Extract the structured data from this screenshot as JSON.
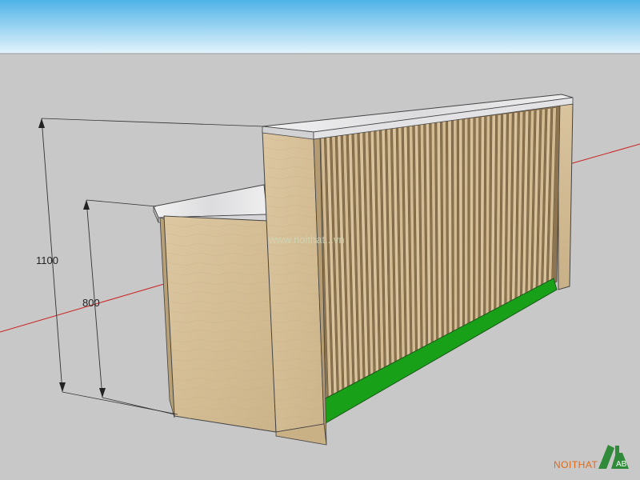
{
  "dimensions": {
    "total_height": "1100",
    "counter_height": "800"
  },
  "watermark": "www.noithat...vn",
  "brand": {
    "text": "NOITHAT",
    "mark": "AB"
  },
  "colors": {
    "sky_top": "#4fb3e8",
    "sky_bottom": "#e3f3fb",
    "ground": "#c8c8c8",
    "wood": "#d8c39c",
    "wood_dark": "#bfa77e",
    "marble": "#e9e9ea",
    "plinth": "#18a018",
    "axis_red": "#cc2222"
  }
}
